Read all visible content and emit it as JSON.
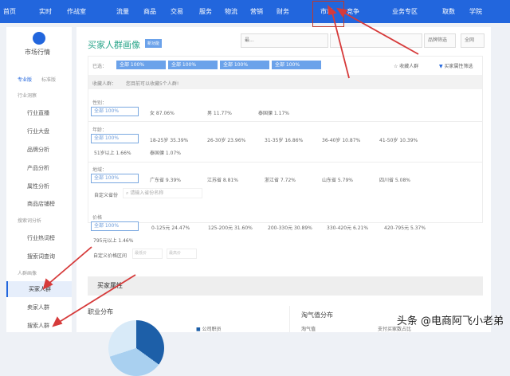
{
  "nav": {
    "items": [
      "首页",
      "实时",
      "作战室",
      "流量",
      "商品",
      "交易",
      "服务",
      "物流",
      "营销",
      "财务",
      "市场",
      "竞争",
      "业务专区",
      "取数",
      "学院"
    ]
  },
  "sidebar": {
    "title": "市场行情",
    "tabs": [
      "专业版",
      "标准版"
    ],
    "items": [
      {
        "label": "行业洞察",
        "group": true
      },
      {
        "label": "行业直播"
      },
      {
        "label": "行业大盘"
      },
      {
        "label": "品牌分析"
      },
      {
        "label": "产品分析"
      },
      {
        "label": "属性分析"
      },
      {
        "label": "商品店铺榜"
      },
      {
        "label": "搜索词分析",
        "group": true
      },
      {
        "label": "行业热词榜"
      },
      {
        "label": "搜索词查询"
      },
      {
        "label": "人群画像",
        "group": true
      },
      {
        "label": "买家人群",
        "active": true
      },
      {
        "label": "卖家人群"
      },
      {
        "label": "搜索人群"
      }
    ]
  },
  "header": {
    "title": "买家人群画像",
    "badge": "新功能",
    "filter1": "最...",
    "filter2": "",
    "filter3": "品牌筛选",
    "scope": "全网"
  },
  "selected": {
    "label": "已选：",
    "chips": [
      "全部 100%",
      "全部 100%",
      "全部 100%",
      "全部 100%"
    ],
    "fav": "收藏人群",
    "filter": "买家属性筛选"
  },
  "notice": {
    "label": "收藏人群：",
    "text": "您目前可以收藏5个人群!"
  },
  "gender": {
    "label": "性别：",
    "all": "全部  100%",
    "items": [
      "女  87.06%",
      "男  11.77%",
      "泰国傈  1.17%"
    ]
  },
  "age": {
    "label": "年龄：",
    "all": "全部  100%",
    "items": [
      "18-25岁  35.39%",
      "26-30岁  23.96%",
      "31-35岁  16.86%",
      "36-40岁  10.87%",
      "41-50岁  10.39%",
      "51岁以上  1.66%",
      "泰国傈  1.07%"
    ]
  },
  "region": {
    "label": "地域：",
    "all": "全部  100%",
    "items": [
      "广东省  9.39%",
      "江苏省  8.81%",
      "浙江省  7.72%",
      "山东省  5.79%",
      "四川省  5.08%"
    ],
    "custom": "自定义省份",
    "placeholder": "请输入省份名称"
  },
  "price": {
    "label": "价格",
    "all": "全部  100%",
    "items": [
      "0-125元  24.47%",
      "125-200元  31.60%",
      "200-330元  30.89%",
      "330-420元  6.21%",
      "420-795元  5.37%",
      "795元以上  1.46%"
    ],
    "custom": "自定义价格区间",
    "min": "最低价",
    "max": "最高价"
  },
  "attrs": {
    "title": "买家属性",
    "job": "职业分布",
    "job_legend": "公司职员",
    "taoqi": "淘气值分布",
    "taoqi_col": "淘气值",
    "taoqi_col2": "支付买家数占比"
  },
  "watermark": "头条 @电商阿飞小老弟"
}
